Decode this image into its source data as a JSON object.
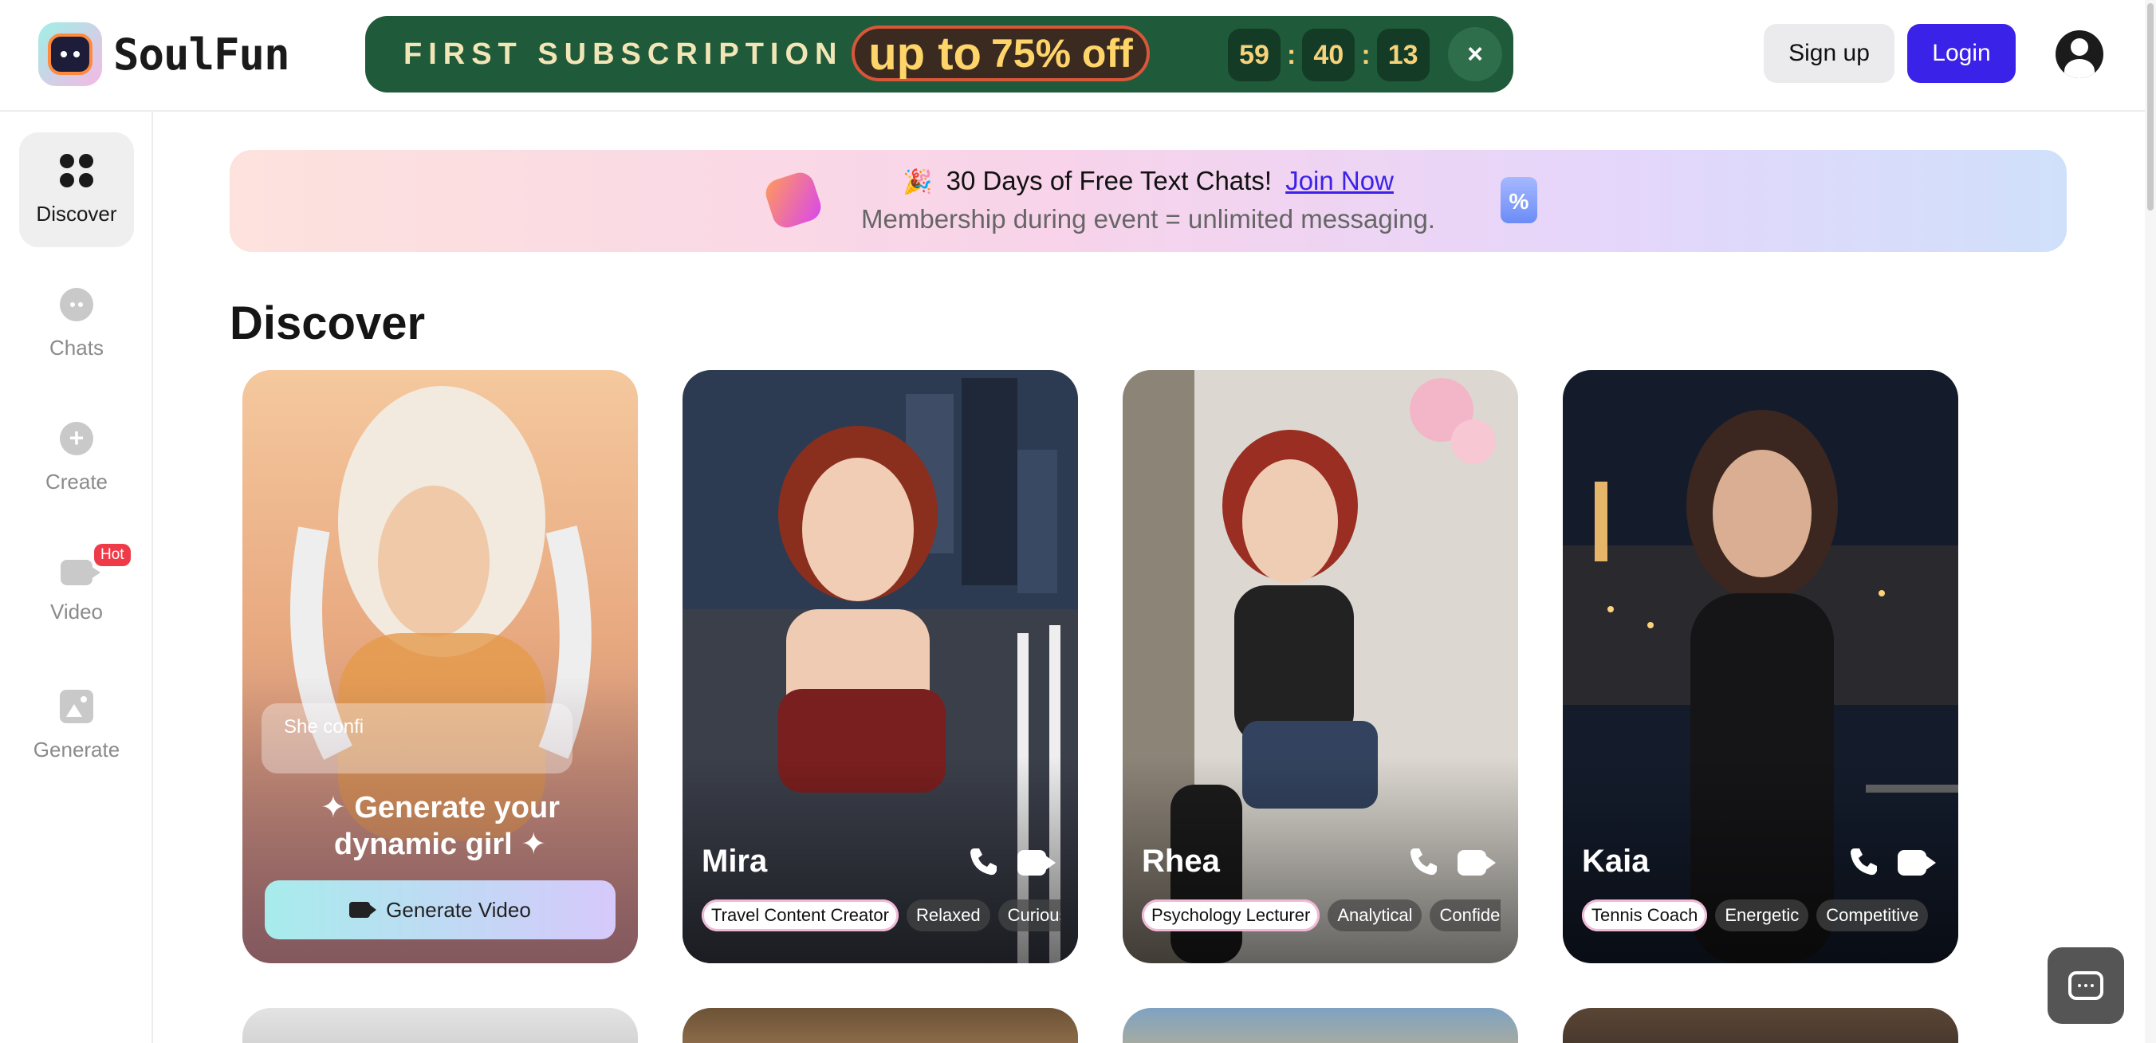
{
  "app": {
    "brand": "SoulFun"
  },
  "promo": {
    "title": "FIRST SUBSCRIPTION",
    "offer_prefix": "up to",
    "offer_value": "75% off",
    "timer": [
      "59",
      "40",
      "13"
    ],
    "close": "×"
  },
  "auth": {
    "signup": "Sign up",
    "login": "Login"
  },
  "sidebar": {
    "items": [
      {
        "label": "Discover",
        "icon": "grid-icon"
      },
      {
        "label": "Chats",
        "icon": "chat-icon"
      },
      {
        "label": "Create",
        "icon": "plus-icon"
      },
      {
        "label": "Video",
        "icon": "video-icon",
        "badge": "Hot"
      },
      {
        "label": "Generate",
        "icon": "image-icon"
      }
    ]
  },
  "banner": {
    "emoji": "🎉",
    "text": "30 Days of Free Text Chats!",
    "link": "Join Now",
    "subtext": "Membership during event = unlimited messaging.",
    "tag_glyph": "%"
  },
  "main": {
    "heading": "Discover"
  },
  "generate_card": {
    "input_value": "She confi",
    "title_line1": "✦ Generate your",
    "title_line2": "dynamic girl ✦",
    "button": "Generate Video"
  },
  "characters": [
    {
      "name": "Mira",
      "tags": [
        "Travel Content Creator",
        "Relaxed",
        "Curious"
      ]
    },
    {
      "name": "Rhea",
      "tags": [
        "Psychology Lecturer",
        "Analytical",
        "Confident"
      ]
    },
    {
      "name": "Kaia",
      "tags": [
        "Tennis Coach",
        "Energetic",
        "Competitive"
      ]
    }
  ],
  "colors": {
    "accent": "#3b22e8",
    "promo_bg": "#1f5a3a",
    "hot_badge": "#ef3b48"
  }
}
